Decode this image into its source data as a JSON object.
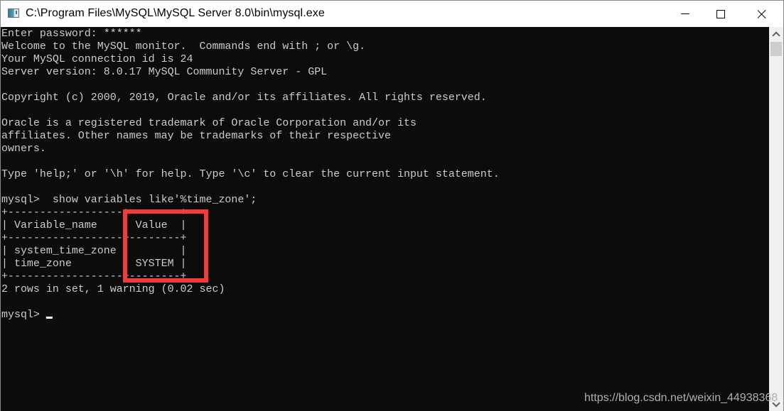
{
  "window": {
    "title": "C:\\Program Files\\MySQL\\MySQL Server 8.0\\bin\\mysql.exe",
    "icon": "console-app-icon",
    "controls": {
      "minimize": "minimize-icon",
      "maximize": "maximize-icon",
      "close": "close-icon"
    }
  },
  "console": {
    "lines": [
      "Enter password: ******",
      "Welcome to the MySQL monitor.  Commands end with ; or \\g.",
      "Your MySQL connection id is 24",
      "Server version: 8.0.17 MySQL Community Server - GPL",
      "",
      "Copyright (c) 2000, 2019, Oracle and/or its affiliates. All rights reserved.",
      "",
      "Oracle is a registered trademark of Oracle Corporation and/or its",
      "affiliates. Other names may be trademarks of their respective",
      "owners.",
      "",
      "Type 'help;' or '\\h' for help. Type '\\c' to clear the current input statement.",
      "",
      "mysql>  show variables like'%time_zone';",
      "+------------------+--------+",
      "| Variable_name    | Value  |",
      "+------------------+--------+",
      "| system_time_zone |        |",
      "| time_zone        | SYSTEM |",
      "+------------------+--------+",
      "2 rows in set, 1 warning (0.02 sec)",
      "",
      "mysql> "
    ],
    "query": {
      "command": "show variables like'%time_zone';",
      "columns": [
        "Variable_name",
        "Value"
      ],
      "rows": [
        [
          "system_time_zone",
          ""
        ],
        [
          "time_zone",
          "SYSTEM"
        ]
      ],
      "result_summary": "2 rows in set, 1 warning (0.02 sec)"
    },
    "prompt": "mysql> ",
    "highlight_color": "#f33b3b"
  },
  "watermark": "https://blog.csdn.net/weixin_44938368"
}
